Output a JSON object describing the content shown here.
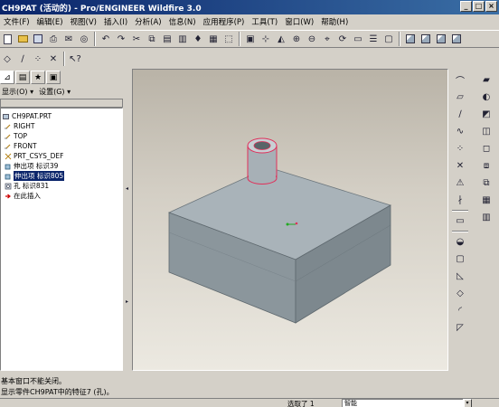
{
  "window": {
    "title": "CH9PAT (活动的) - Pro/ENGINEER Wildfire 3.0",
    "buttons": [
      "_",
      "□",
      "×"
    ]
  },
  "menu": [
    "文件(F)",
    "编辑(E)",
    "视图(V)",
    "插入(I)",
    "分析(A)",
    "信息(N)",
    "应用程序(P)",
    "工具(T)",
    "窗口(W)",
    "帮助(H)"
  ],
  "model_tree": {
    "show_label": "显示(O) ▾",
    "settings_label": "设置(G) ▾",
    "items": [
      {
        "label": "CH9PAT.PRT",
        "icon": "part-icon"
      },
      {
        "label": "RIGHT",
        "icon": "datum-plane-icon"
      },
      {
        "label": "TOP",
        "icon": "datum-plane-icon"
      },
      {
        "label": "FRONT",
        "icon": "datum-plane-icon"
      },
      {
        "label": "PRT_CSYS_DEF",
        "icon": "csys-icon"
      },
      {
        "label": "伸出项 标识39",
        "icon": "extrude-icon"
      },
      {
        "label": "伸出项 标识805",
        "icon": "extrude-icon",
        "selected": true
      },
      {
        "label": "孔 标识831",
        "icon": "hole-icon"
      },
      {
        "label": "在此插入",
        "icon": "insert-here-icon"
      }
    ]
  },
  "messages": [
    "基本窗口不能关闭。",
    "显示零件CH9PAT中的特征7 (孔)。"
  ],
  "status": {
    "selected": "选取了 1",
    "filter": "智能"
  },
  "colors": {
    "title_bar": "#0a246a",
    "model_face": "#a9b3b9",
    "highlight": "#e0305a"
  }
}
